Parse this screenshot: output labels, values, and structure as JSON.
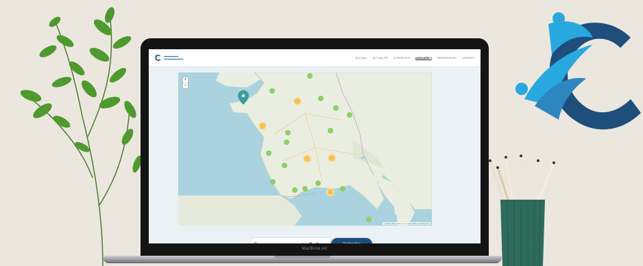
{
  "device": {
    "model_label": "MacBook Air"
  },
  "site": {
    "nav": [
      "ACCUEIL",
      "ACTUALITÉ",
      "À PROPOS ▾",
      "ANNUAIRE ▾",
      "RESSOURCES",
      "CONTACT"
    ],
    "active_nav_index": 3
  },
  "map": {
    "zoom_in": "+",
    "zoom_out": "−",
    "attribution": "Leaflet | Map data © OpenStreetMap contributors",
    "marker_colors": {
      "single": "#8ccf6a",
      "cluster": "#f4c055",
      "pin": "#3a9f9a"
    },
    "search": {
      "placeholder": "Recherche de structure",
      "button_label": "Rechercher"
    }
  },
  "colors": {
    "background": "#ebe7df",
    "brand_dark_blue": "#1e4f7c",
    "brand_light_blue": "#29a8e0",
    "cup_green": "#2f6b5a"
  }
}
